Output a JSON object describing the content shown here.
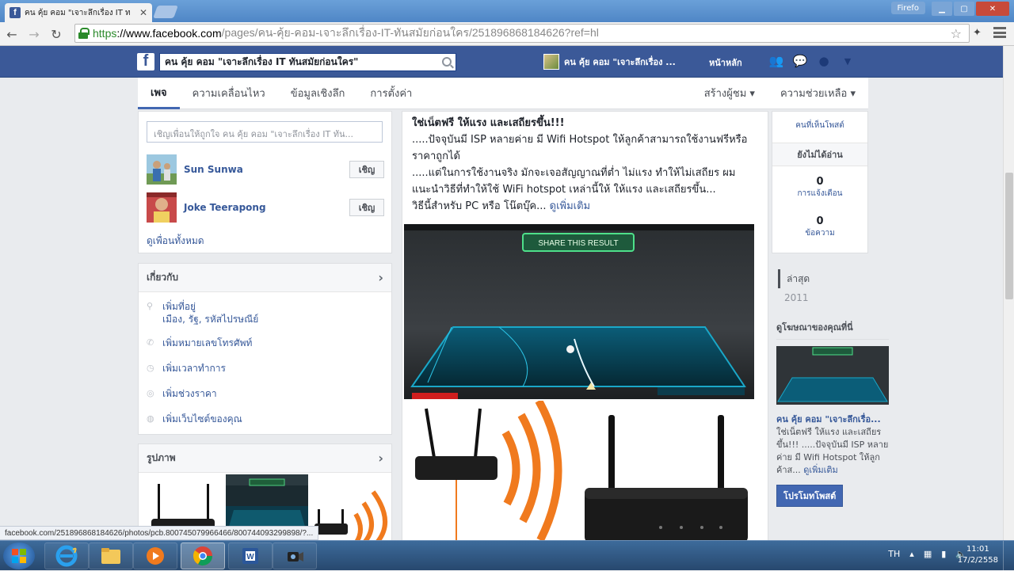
{
  "browser": {
    "tab_title": "คน คุ้ย คอม \"เจาะลึกเรื่อง IT ท",
    "window_user": "Firefo",
    "url_https": "https",
    "url_host": "://www.facebook.com",
    "url_path": "/pages/คน-คุ้ย-คอม-เจาะลึกเรื่อง-IT-ทันสมัยก่อนใคร/251896868184626?ref=hl"
  },
  "fb_header": {
    "search_value": "คน คุ้ย คอม \"เจาะลึกเรื่อง IT ทันสมัยก่อนใคร\"",
    "profile_name": "คน คุ้ย คอม \"เจาะลึกเรื่อง ...",
    "home_label": "หน้าหลัก"
  },
  "page_nav": {
    "items": [
      "เพจ",
      "ความเคลื่อนไหว",
      "ข้อมูลเชิงลึก",
      "การตั้งค่า"
    ],
    "create_audience": "สร้างผู้ชม ▾",
    "help": "ความช่วยเหลือ ▾"
  },
  "invite": {
    "placeholder": "เชิญเพื่อนให้ถูกใจ คน คุ้ย คอม \"เจาะลึกเรื่อง IT ทัน...",
    "friends": [
      {
        "name": "Sun Sunwa",
        "button": "เชิญ"
      },
      {
        "name": "Joke Teerapong",
        "button": "เชิญ"
      }
    ],
    "see_all": "ดูเพื่อนทั้งหมด"
  },
  "about": {
    "title": "เกี่ยวกับ",
    "add_location": "เพิ่มที่อยู่",
    "location_sub": "เมือง, รัฐ, รหัสไปรษณีย์",
    "add_phone": "เพิ่มหมายเลขโทรศัพท์",
    "add_hours": "เพิ่มเวลาทำการ",
    "add_price": "เพิ่มช่วงราคา",
    "add_website": "เพิ่มเว็บไซต์ของคุณ"
  },
  "photos": {
    "title": "รูปภาพ"
  },
  "post": {
    "line1": "ใช่เน็ตฟรี ให้แรง และเสถียรขึ้น!!!",
    "line2": ".....ปัจจุบันมี ISP หลายค่าย มี Wifi Hotspot ให้ลูกค้าสามารถใช้งานฟรีหรือราคาถูกได้",
    "line3": ".....แต่ในการใช้งานจริง มักจะเจอสัญญาณที่ต่ำ ไม่แรง ทำให้ไม่เสถียร ผมแนะนำวิธีที่ทำให้ใช้ WiFi hotspot เหล่านี้ให้ ให้แรง และเสถียรขึ้น...",
    "line4": "วิธีนี้สำหรับ PC หรือ โน๊ตบุ๊ค...",
    "see_more": "ดูเพิ่มเติม",
    "share_result": "SHARE THIS RESULT"
  },
  "right_stats": {
    "top_label": "คนที่เห็นโพสต์",
    "unread": "ยังไม่ได้อ่าน",
    "notif_count": "0",
    "notif_label": "การแจ้งเตือน",
    "msg_count": "0",
    "msg_label": "ข้อความ"
  },
  "timeline": [
    "ล่าสุด",
    "2011"
  ],
  "promo": {
    "title": "ดูโฆษณาของคุณที่นี่",
    "page_name": "คน คุ้ย คอม \"เจาะลึกเรื่อ...",
    "text": "ใช่เน็ตฟรี ให้แรง และเสถียรขึ้น!!! .....ปัจจุบันมี ISP หลายค่าย มี Wifi Hotspot ให้ลูกค้าส...",
    "see_more": "ดูเพิ่มเติม",
    "button": "โปรโมทโพสต์"
  },
  "status_bar": "facebook.com/251896868184626/photos/pcb.800745079966466/800744093299898/?...",
  "taskbar": {
    "lang": "TH",
    "time": "11:01",
    "date": "17/2/2558"
  },
  "colors": {
    "fb_blue": "#3b5998",
    "link": "#365899",
    "router_orange": "#f07a1e"
  }
}
